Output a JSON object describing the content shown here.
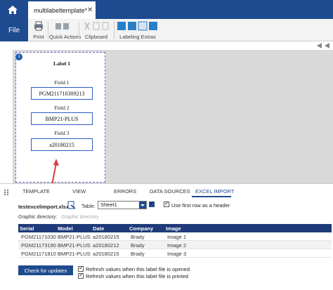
{
  "tab": {
    "document_title": "multilabeltemplate*",
    "close_glyph": "✕"
  },
  "ribbon": {
    "file_label": "File",
    "groups": [
      {
        "label": "Print",
        "icon": "printer-icon"
      },
      {
        "label": "Quick Actions",
        "icon": "quick-actions-icon"
      },
      {
        "label": "Clipboard",
        "icon": "clipboard-icon"
      },
      {
        "label": "Labeling Extras",
        "icon": "labeling-extras-icon"
      }
    ]
  },
  "label": {
    "page_number": "1",
    "title": "Label 1",
    "fields": [
      {
        "caption": "Field 1",
        "value": "PGM211710309213"
      },
      {
        "caption": "Field 2",
        "value": "BMP21-PLUS"
      },
      {
        "caption": "Field 3",
        "value": "a20180215"
      }
    ]
  },
  "panel": {
    "tabs": [
      "TEMPLATE",
      "VIEW",
      "ERRORS",
      "DATA SOURCES",
      "EXCEL IMPORT"
    ],
    "active_tab": "EXCEL IMPORT",
    "file_name": "testexcelimport.xlsx",
    "table_label": "Table:",
    "table_value": "Sheet1",
    "first_row_header_label": "Use first row as a header",
    "graphic_dir_label": "Graphic directory:",
    "graphic_dir_placeholder": "Graphic directory",
    "grid": {
      "columns": [
        "Serial",
        "Model",
        "Date",
        "Company",
        "Image"
      ],
      "rows": [
        [
          "PGM21171030",
          "BMP21-PLUS",
          "a20180215",
          "Brady",
          "Image 1"
        ],
        [
          "PGM21173190",
          "BMP21-PLUS",
          "a20180212",
          "Brady",
          "Image 2"
        ],
        [
          "PGM21171810",
          "BMP21-PLUS",
          "a20180215",
          "Brady",
          "Image 3"
        ]
      ]
    },
    "check_updates_label": "Check for updates",
    "refresh_opened_label": "Refresh values when this label file is opened",
    "refresh_printed_label": "Refresh values when this label file is printed"
  },
  "colors": {
    "brand": "#1e4b8f",
    "grid_header": "#1e3a78",
    "annotation_arrow": "#e03a3a"
  }
}
